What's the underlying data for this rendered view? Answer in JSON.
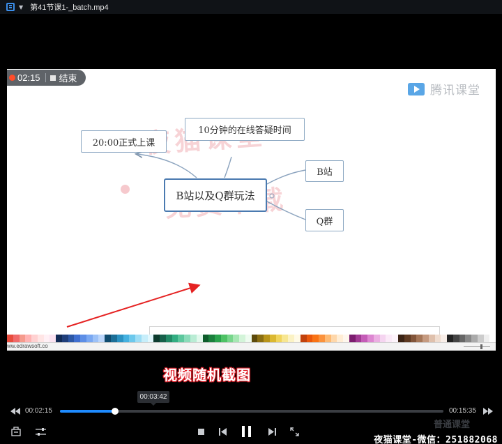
{
  "window": {
    "title": "第41节课1-_batch.mp4"
  },
  "recording": {
    "elapsed": "02:15",
    "end_label": "结束"
  },
  "brand": {
    "name": "腾讯课堂"
  },
  "mindmap": {
    "center": "B站以及Q群玩法",
    "nodes": [
      "20:00正式上课",
      "10分钟的在线答疑时间",
      "B站",
      "Q群"
    ]
  },
  "watermark": {
    "line1": "夜猫课堂",
    "line2": "免费下载"
  },
  "footer": {
    "url": "ww.edrawsoft.co"
  },
  "caption": "视频随机截图",
  "player": {
    "hover_time": "00:03:42",
    "current_time": "00:02:15",
    "total_time": "00:15:35",
    "progress": 0.1444
  },
  "overlay_text": "夜猫课堂-微信：251882068",
  "ghost_logo": "普通课堂",
  "colors": {
    "accent": "#1e8bff",
    "record_dot": "#ff4d2a",
    "node_border": "#4a7ab0",
    "arrow": "#e52222"
  },
  "icons": [
    "playlist-icon",
    "chevron-down-icon",
    "tencent-play-icon",
    "rewind-icon",
    "fast-forward-icon",
    "file-icon",
    "settings-sliders-icon",
    "stop-icon",
    "previous-icon",
    "pause-icon",
    "next-icon",
    "fullscreen-icon"
  ]
}
